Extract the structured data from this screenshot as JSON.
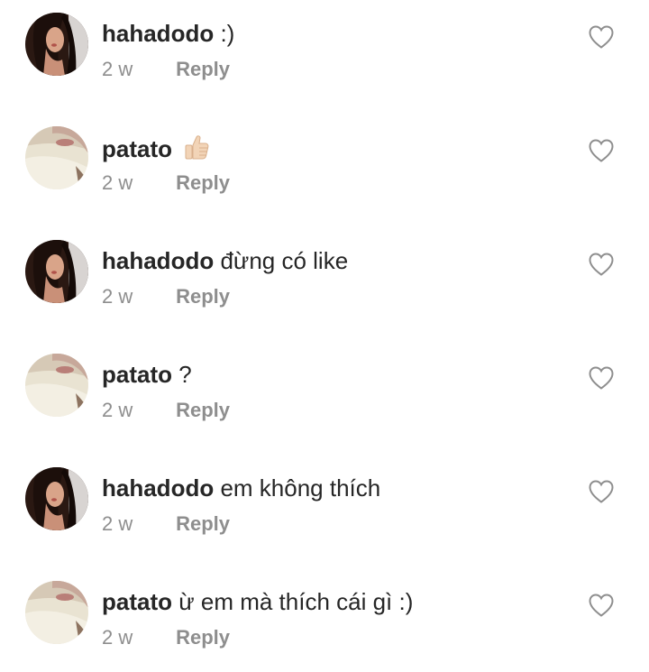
{
  "comments": [
    {
      "author": "hahadodo",
      "text": ":)",
      "time": "2 w",
      "reply_label": "Reply",
      "avatar": "girl-avatar",
      "emoji": ""
    },
    {
      "author": "patato",
      "text": "",
      "time": "2 w",
      "reply_label": "Reply",
      "avatar": "pale-avatar",
      "emoji": "thumbs-up"
    },
    {
      "author": "hahadodo",
      "text": "đừng có like",
      "time": "2 w",
      "reply_label": "Reply",
      "avatar": "girl-avatar",
      "emoji": ""
    },
    {
      "author": "patato",
      "text": "?",
      "time": "2 w",
      "reply_label": "Reply",
      "avatar": "pale-avatar",
      "emoji": ""
    },
    {
      "author": "hahadodo",
      "text": "em không thích",
      "time": "2 w",
      "reply_label": "Reply",
      "avatar": "girl-avatar",
      "emoji": ""
    },
    {
      "author": "patato",
      "text": "ừ em mà thích cái gì :)",
      "time": "2 w",
      "reply_label": "Reply",
      "avatar": "pale-avatar",
      "emoji": ""
    }
  ],
  "colors": {
    "text": "#262626",
    "muted": "#8e8e8e",
    "heart_outline": "#8e8e8e",
    "background": "#ffffff"
  }
}
